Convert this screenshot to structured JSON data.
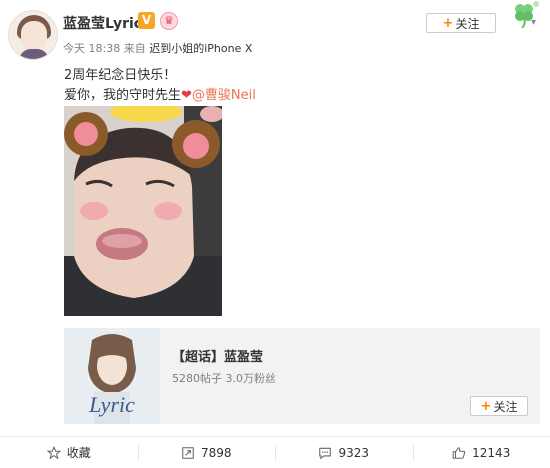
{
  "post": {
    "username": "蓝盈莹Lyric",
    "verified_badge": "V",
    "crown_icon": "crown-icon",
    "time": "今天 18:38",
    "source_prefix": "来自",
    "source": "迟到小姐的iPhone X",
    "follow_label": "关注",
    "line1": "2周年纪念日快乐！",
    "line2_prefix": "爱你，我的守时先生",
    "mention": "@曹骏Neil"
  },
  "shared": {
    "title": "【超话】蓝盈莹",
    "stats": "5280帖子 3.0万粉丝",
    "thumb_text": "Lyric",
    "follow_label": "关注"
  },
  "actions": {
    "favorite": "收藏",
    "repost": "7898",
    "comment": "9323",
    "like": "12143"
  },
  "colors": {
    "accent_orange": "#ff8200",
    "mention": "#eb7350",
    "heart": "#e23d4b"
  }
}
